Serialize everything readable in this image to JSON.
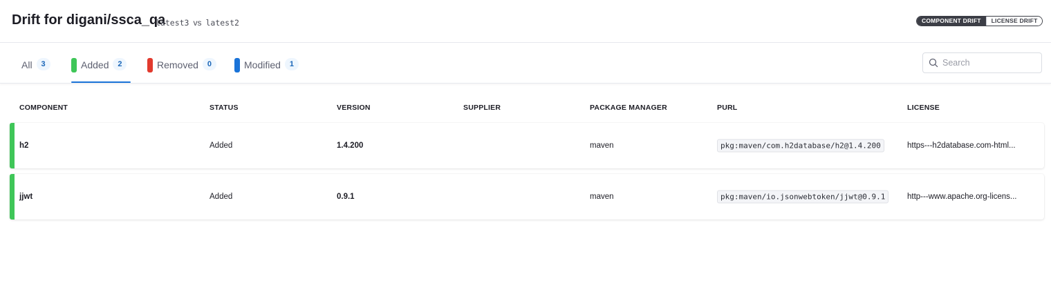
{
  "header": {
    "title": "Drift for digani/ssca_qa",
    "version_a": "latest3",
    "vs_label": "vs",
    "version_b": "latest2",
    "toggle": {
      "component_drift": "COMPONENT DRIFT",
      "license_drift": "LICENSE DRIFT",
      "active": "component_drift"
    }
  },
  "tabs": [
    {
      "label": "All",
      "count": "3",
      "color": ""
    },
    {
      "label": "Added",
      "count": "2",
      "color": "#3fc658"
    },
    {
      "label": "Removed",
      "count": "0",
      "color": "#e23a2e"
    },
    {
      "label": "Modified",
      "count": "1",
      "color": "#1a73d8"
    }
  ],
  "active_tab": "Added",
  "search": {
    "placeholder": "Search",
    "value": ""
  },
  "table": {
    "columns": [
      "COMPONENT",
      "STATUS",
      "VERSION",
      "SUPPLIER",
      "PACKAGE MANAGER",
      "PURL",
      "LICENSE"
    ],
    "rows": [
      {
        "component": "h2",
        "status": "Added",
        "version": "1.4.200",
        "supplier": "",
        "package_manager": "maven",
        "purl": "pkg:maven/com.h2database/h2@1.4.200",
        "license": "https---h2database.com-html...",
        "accent_color": "#3fc658"
      },
      {
        "component": "jjwt",
        "status": "Added",
        "version": "0.9.1",
        "supplier": "",
        "package_manager": "maven",
        "purl": "pkg:maven/io.jsonwebtoken/jjwt@0.9.1",
        "license": "http---www.apache.org-licens...",
        "accent_color": "#3fc658"
      }
    ]
  },
  "icons": {
    "search": "search-icon"
  }
}
